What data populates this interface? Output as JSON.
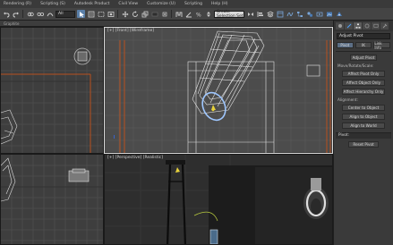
{
  "menubar": {
    "items": [
      "Rendering (R)",
      "Scripting (S)",
      "Autodesk Product",
      "Civil View",
      "Customize (U)",
      "Scripting",
      "Help (H)"
    ]
  },
  "toolbar": {
    "selection_filter": "All",
    "named_selection": "Create Selection Set",
    "icons": [
      "undo-icon",
      "redo-icon",
      "link-icon",
      "unlink-icon",
      "bind-space-warp-icon",
      "select-object-icon",
      "select-by-name-icon",
      "rectangular-selection-icon",
      "window-crossing-icon",
      "select-and-move-icon",
      "select-and-rotate-icon",
      "select-and-scale-icon",
      "reference-coordinate-icon",
      "pivot-center-icon",
      "snaps-toggle-icon",
      "angle-snap-icon",
      "percent-snap-icon",
      "spinner-snap-icon",
      "mirror-icon",
      "align-icon",
      "layer-manager-icon",
      "graphite-ribbon-icon",
      "curve-editor-icon",
      "schematic-view-icon",
      "material-editor-icon",
      "render-setup-icon",
      "rendered-frame-icon",
      "render-production-icon"
    ]
  },
  "subbar": {
    "label": "Graphite"
  },
  "viewports": {
    "top": {
      "label": ""
    },
    "front": {
      "label": "[+] [Front] [Wireframe]"
    },
    "left": {
      "label": ""
    },
    "perspective": {
      "label": "[+] [Perspective] [Realistic]"
    }
  },
  "panel": {
    "tabs": [
      "create-icon",
      "modify-icon",
      "hierarchy-icon",
      "motion-icon",
      "display-icon",
      "utilities-icon"
    ],
    "object_name": "Adjust Pivot",
    "subtabs": [
      "Pivot",
      "IK",
      "Link Info"
    ],
    "section1_title": "Adjust Pivot",
    "move_rotate_label": "Move/Rotate/Scale:",
    "buttons1": [
      "Affect Pivot Only",
      "Affect Object Only",
      "Affect Hierarchy Only"
    ],
    "alignment_label": "Alignment:",
    "buttons2": [
      "Center to Object",
      "Align to Object",
      "Align to World"
    ],
    "pivot_label": "Pivot:",
    "reset_button": "Reset Pivot"
  },
  "colors": {
    "accent": "#5a7fa8",
    "active_border": "#d9d9d9",
    "grid_line": "#585858",
    "guide_orange": "#b8501e",
    "wireframe": "#e6e6e6",
    "gizmo_yellow": "#e8d23c"
  }
}
